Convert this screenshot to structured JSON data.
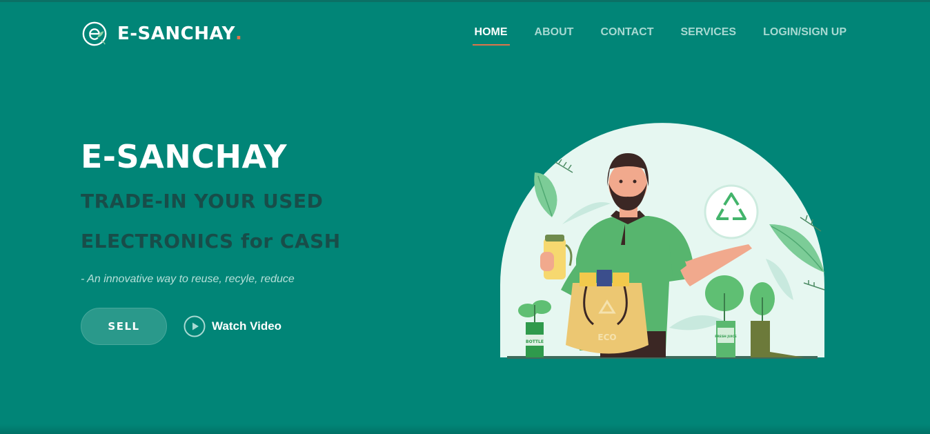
{
  "brand": {
    "name": "E-SANCHAY",
    "dot": ".",
    "logo_icon": "recycle-leaf-logo-icon"
  },
  "nav": {
    "items": [
      {
        "label": "HOME",
        "active": true
      },
      {
        "label": "ABOUT",
        "active": false
      },
      {
        "label": "CONTACT",
        "active": false
      },
      {
        "label": "SERVICES",
        "active": false
      },
      {
        "label": "LOGIN/SIGN UP",
        "active": false
      }
    ]
  },
  "hero": {
    "title": "E-SANCHAY",
    "tagline_line1": "TRADE-IN YOUR USED",
    "tagline_line2": "ELECTRONICS for CASH",
    "subtitle": "- An innovative way to reuse, recyle, reduce",
    "sell_label": "SELL",
    "watch_label": "Watch Video",
    "watch_icon": "play-circle-icon"
  },
  "illustration": {
    "bag_label": "ECO",
    "bottle_label": "BOTTLE",
    "juice_label": "FRESH JUICE",
    "recycle_icon": "recycle-icon"
  },
  "colors": {
    "background": "#018577",
    "accent": "#e0744a",
    "tagline": "#184d49",
    "illustration_bg": "#e6f7f1"
  }
}
